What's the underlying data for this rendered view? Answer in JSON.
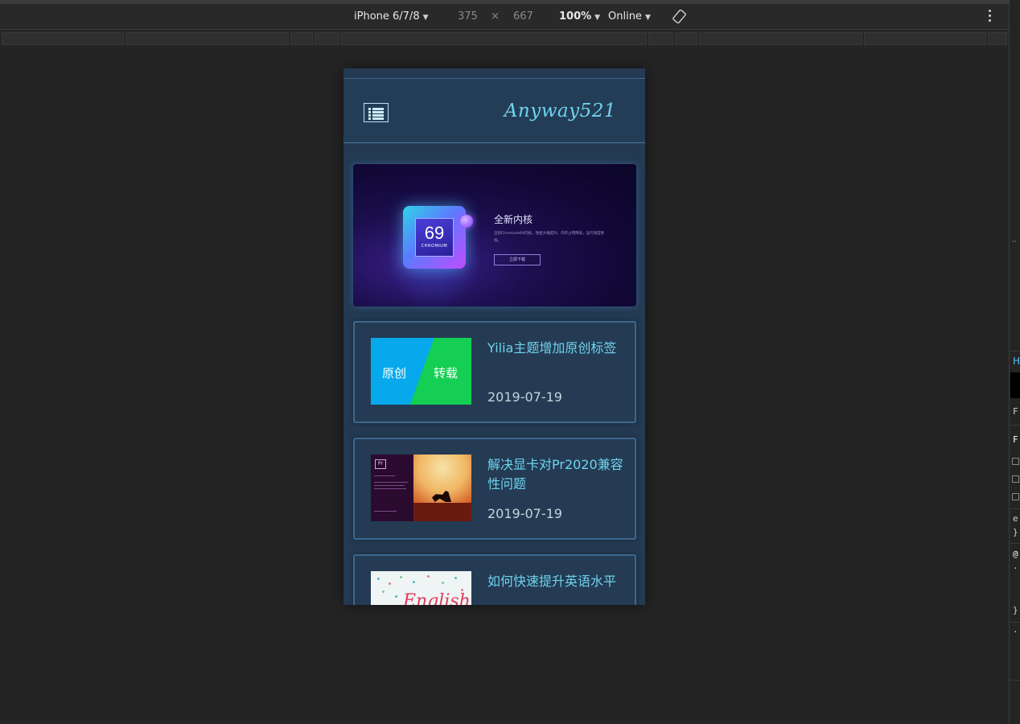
{
  "devtools": {
    "device": "iPhone 6/7/8",
    "width": "375",
    "times": "×",
    "height": "667",
    "zoom": "100%",
    "network": "Online"
  },
  "site": {
    "brand": "Anyway521",
    "banner": {
      "chip_number": "69",
      "chip_label": "CHROMIUM",
      "title": "全新内核",
      "subtitle": "全新Chromium69内核，性能大幅提升，内存占用降低，运行速度更快。",
      "button": "立即下载"
    },
    "posts": [
      {
        "title": "Yilia主题增加原创标签",
        "date": "2019-07-19",
        "thumb_labels": [
          "原创",
          "转载"
        ]
      },
      {
        "title": "解决显卡对Pr2020兼容性问题",
        "date": "2019-07-19",
        "thumb_logo": "Pr"
      },
      {
        "title": "如何快速提升英语水平",
        "date": "",
        "thumb_text": "English"
      }
    ]
  },
  "colors": {
    "page_bg": "#233a52",
    "accent": "#6fd3ee",
    "card_border": "#3d6790"
  }
}
